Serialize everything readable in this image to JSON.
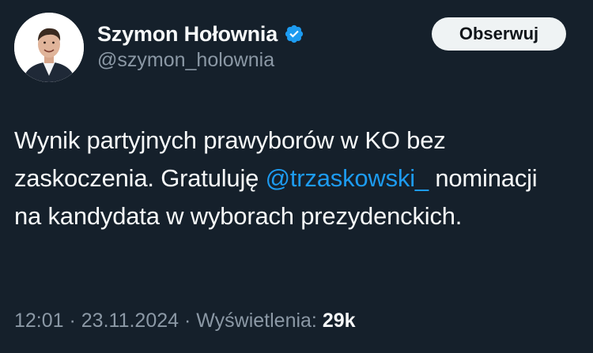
{
  "author": {
    "display_name": "Szymon Hołownia",
    "handle": "@szymon_holownia",
    "avatar_icon": "person-portrait-icon",
    "verified_icon": "verified-badge-icon"
  },
  "actions": {
    "follow_label": "Obserwuj"
  },
  "tweet": {
    "text_before_mention": "Wynik partyjnych prawyborów w KO bez zaskoczenia. Gratuluję ",
    "mention": "@trzaskowski_",
    "text_after_mention": " nominacji na kandydata w wyborach prezydenckich."
  },
  "meta": {
    "time": "12:01",
    "separator": " · ",
    "date": "23.11.2024",
    "views_label": "Wyświetlenia:",
    "views_count": "29k"
  },
  "colors": {
    "background": "#15202b",
    "accent": "#1d9bf0",
    "secondary_text": "#8b98a5",
    "button_bg": "#eff3f4"
  }
}
